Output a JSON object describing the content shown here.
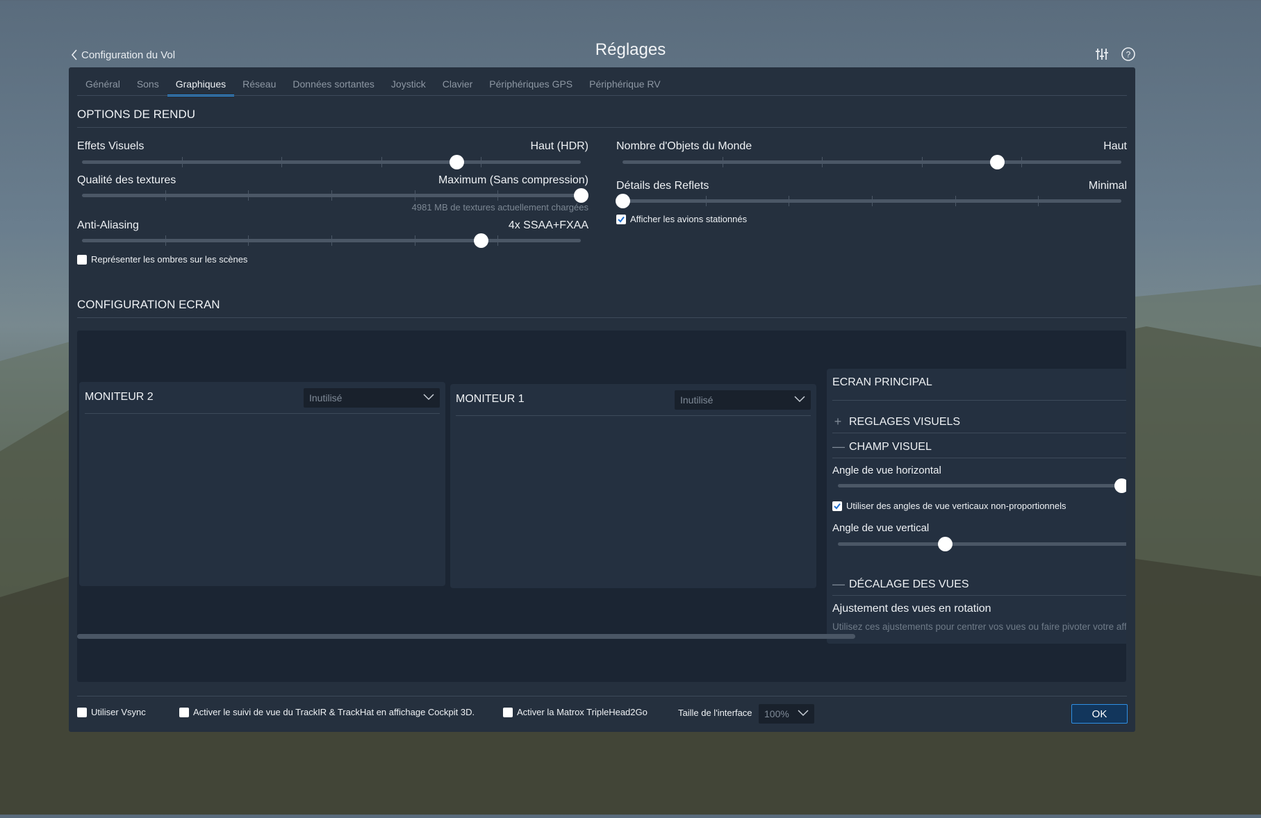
{
  "header": {
    "back_label": "Configuration du Vol",
    "title": "Réglages",
    "icons": [
      "sliders-icon",
      "help-icon"
    ]
  },
  "tabs": [
    {
      "label": "Général",
      "active": false
    },
    {
      "label": "Sons",
      "active": false
    },
    {
      "label": "Graphiques",
      "active": true
    },
    {
      "label": "Réseau",
      "active": false
    },
    {
      "label": "Données sortantes",
      "active": false
    },
    {
      "label": "Joystick",
      "active": false
    },
    {
      "label": "Clavier",
      "active": false
    },
    {
      "label": "Périphériques GPS",
      "active": false
    },
    {
      "label": "Périphérique  RV",
      "active": false
    }
  ],
  "rendering": {
    "title": "OPTIONS DE RENDU",
    "visual_effects": {
      "label": "Effets Visuels",
      "value": "Haut (HDR)",
      "level": 0.75
    },
    "texture_quality": {
      "label": "Qualité des textures",
      "value": "Maximum (Sans compression)",
      "level": 1.0,
      "note": "4981 MB de textures actuellement chargées"
    },
    "anti_aliasing": {
      "label": "Anti-Aliasing",
      "value": "4x SSAA+FXAA",
      "level": 0.8
    },
    "shadows_checkbox": {
      "label": "Représenter les ombres sur les scènes",
      "checked": false
    },
    "world_objects": {
      "label": "Nombre d'Objets du Monde",
      "value": "Haut",
      "level": 0.75
    },
    "reflections": {
      "label": "Détails des Reflets",
      "value": "Minimal",
      "level": 0.0
    },
    "parked_aircraft_checkbox": {
      "label": "Afficher les avions stationnés",
      "checked": true
    }
  },
  "screen": {
    "title": "CONFIGURATION ECRAN",
    "monitor2": {
      "title": "MONITEUR 2",
      "select": "Inutilisé"
    },
    "monitor1": {
      "title": "MONITEUR 1",
      "select": "Inutilisé"
    },
    "principal": {
      "title": "ECRAN PRINCIPAL",
      "visual_settings": {
        "label": "REGLAGES VISUELS",
        "sign": "+"
      },
      "field_of_view": {
        "label": "CHAMP VISUEL",
        "sign": "—"
      },
      "horizontal_angle": {
        "label": "Angle de vue horizontal",
        "level": 1.0
      },
      "nonprop_checkbox": {
        "label": "Utiliser des angles de vue verticaux non-proportionnels",
        "checked": true
      },
      "vertical_angle": {
        "label": "Angle de vue vertical",
        "level": 0.35
      },
      "view_offset": {
        "label": "DÉCALAGE DES VUES",
        "sign": "—"
      },
      "rotation_title": "Ajustement des vues en rotation",
      "rotation_desc": "Utilisez ces ajustements pour centrer vos vues ou faire pivoter votre aff"
    }
  },
  "footer": {
    "vsync": {
      "label": "Utiliser Vsync",
      "checked": false
    },
    "trackir": {
      "label": "Activer le suivi de vue du TrackIR & TrackHat en affichage Cockpit 3D.",
      "checked": false
    },
    "matrox": {
      "label": "Activer la Matrox TripleHead2Go",
      "checked": false
    },
    "ui_size_label": "Taille de l'interface",
    "ui_size_value": "100%",
    "ok_label": "OK"
  },
  "colors": {
    "accent": "#2a8de0",
    "panel": "#25303e",
    "screen_bg": "#1b2533"
  }
}
